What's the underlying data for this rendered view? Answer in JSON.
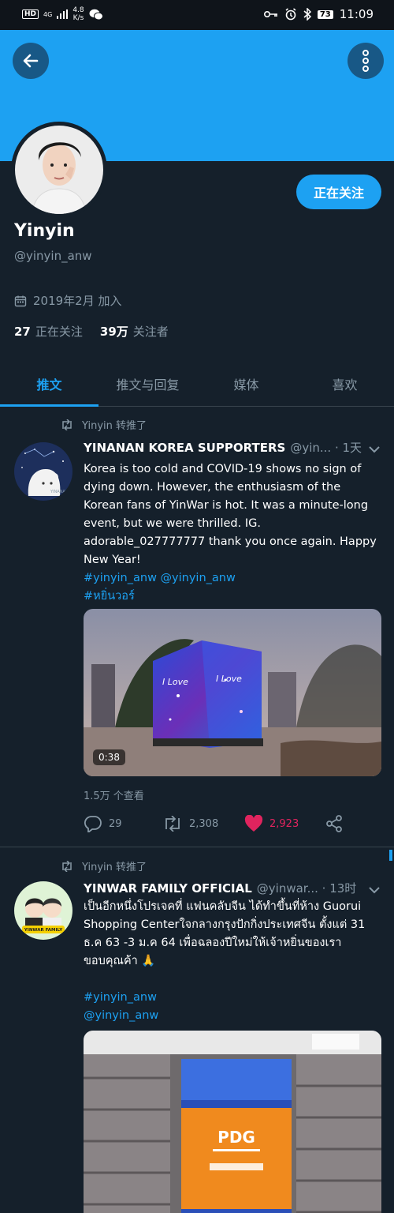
{
  "status": {
    "hd": "HD",
    "signal": "4G",
    "speed_num": "4.8",
    "speed_unit": "K/s",
    "battery": "73",
    "time": "11:09"
  },
  "header": {
    "follow_label": "正在关注"
  },
  "profile": {
    "name": "Yinyin",
    "handle": "@yinyin_anw",
    "joined": "2019年2月 加入",
    "following_count": "27",
    "following_label": "正在关注",
    "followers_count": "39万",
    "followers_label": "关注者"
  },
  "tabs": [
    "推文",
    "推文与回复",
    "媒体",
    "喜欢"
  ],
  "tweets": [
    {
      "retweeted_by": "Yinyin 转推了",
      "author": "YINANAN KOREA SUPPORTERS",
      "handle": "@yin...",
      "time": "· 1天",
      "text": "Korea is too cold and COVID-19 shows no sign of dying down. However, the enthusiasm of the Korean fans of YinWar is hot. It was a minute-long event, but we were thrilled. IG. adorable_027777777 thank you once again. Happy New Year!",
      "links_line1": "#yinyin_anw @yinyin_anw",
      "links_line2": "#หยิ่นวอร์",
      "media_duration": "0:38",
      "views": "1.5万 个查看",
      "replies": "29",
      "retweets": "2,308",
      "likes": "2,923"
    },
    {
      "retweeted_by": "Yinyin 转推了",
      "author": "YINWAR FAMILY OFFICIAL",
      "handle": "@yinwar...",
      "time": "· 13时",
      "text": "เป็นอีกหนึ่งโปรเจคที่ แฟนคลับจีน ได้ทำขึ้นที่ห้าง Guorui Shopping Centerใจกลางกรุงปักกิ่งประเทศจีน ตั้งแต่ 31 ธ.ค 63 -3 ม.ค 64 เพื่อฉลองปีใหม่ให้เจ้าหยิ่นของเรา ขอบคุณค้า 🙏",
      "links_line1": "#yinyin_anw",
      "links_line2": "@yinyin_anw"
    }
  ],
  "colors": {
    "accent": "#1da1f2",
    "background": "#15202b",
    "like": "#e0245e"
  }
}
